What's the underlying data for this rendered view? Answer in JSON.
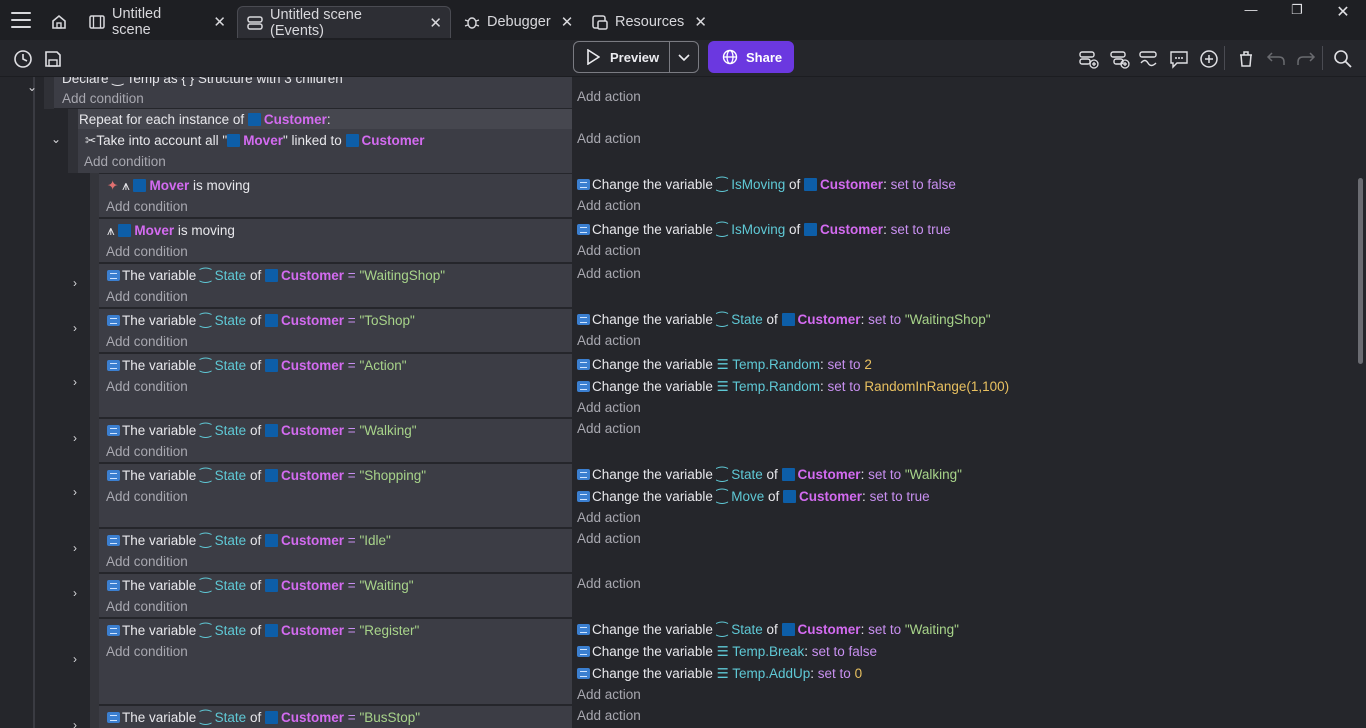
{
  "tabs": [
    {
      "label": "Untitled scene",
      "icon": "film-icon"
    },
    {
      "label": "Untitled scene (Events)",
      "icon": "events-icon"
    },
    {
      "label": "Debugger",
      "icon": "debugger-icon"
    },
    {
      "label": "Resources",
      "icon": "resources-icon"
    }
  ],
  "toolbar": {
    "preview_label": "Preview",
    "share_label": "Share"
  },
  "colors": {
    "accent": "#6b38e0",
    "object": "#d36bf0",
    "variable": "#5fc9d6",
    "string": "#a8d48a",
    "number": "#e8c060"
  },
  "events": {
    "declare_text": "Declare ⁐ Temp as { } Structure with 3 children",
    "add_condition": "Add condition",
    "add_action": "Add action",
    "repeat": {
      "prefix": "Repeat for each instance of",
      "object": "Customer",
      "suffix": ":"
    },
    "take_account": {
      "prefix": "Take into account all \"",
      "object": "Mover",
      "mid": "\" linked to",
      "object2": "Customer"
    },
    "mover1": {
      "object": "Mover",
      "text": "is moving"
    },
    "mover2": {
      "object": "Mover",
      "text": "is moving"
    },
    "the_variable": "The variable",
    "of": "of",
    "eq": "=",
    "state_var": "State",
    "customer": "Customer",
    "change_var": "Change the variable",
    "isMoving": "IsMoving",
    "set_to": "set to",
    "set_to_false": "set to false",
    "set_to_true": "set to true",
    "rows": [
      {
        "value": "\"WaitingShop\""
      },
      {
        "value": "\"ToShop\""
      },
      {
        "value": "\"Action\""
      },
      {
        "value": "\"Walking\""
      },
      {
        "value": "\"Shopping\""
      },
      {
        "value": "\"Idle\""
      },
      {
        "value": "\"Waiting\""
      },
      {
        "value": "\"Register\""
      },
      {
        "value": "\"BusStop\""
      }
    ],
    "actions": {
      "toShop_value": "\"WaitingShop\"",
      "temp_random": "Temp.Random",
      "random_value1": "2",
      "random_value2": "RandomInRange(1,100)",
      "shopping_value": "\"Walking\"",
      "move_var": "Move",
      "register_value": "\"Waiting\"",
      "temp_break": "Temp.Break",
      "temp_addup": "Temp.AddUp",
      "addup_value": "0"
    }
  }
}
